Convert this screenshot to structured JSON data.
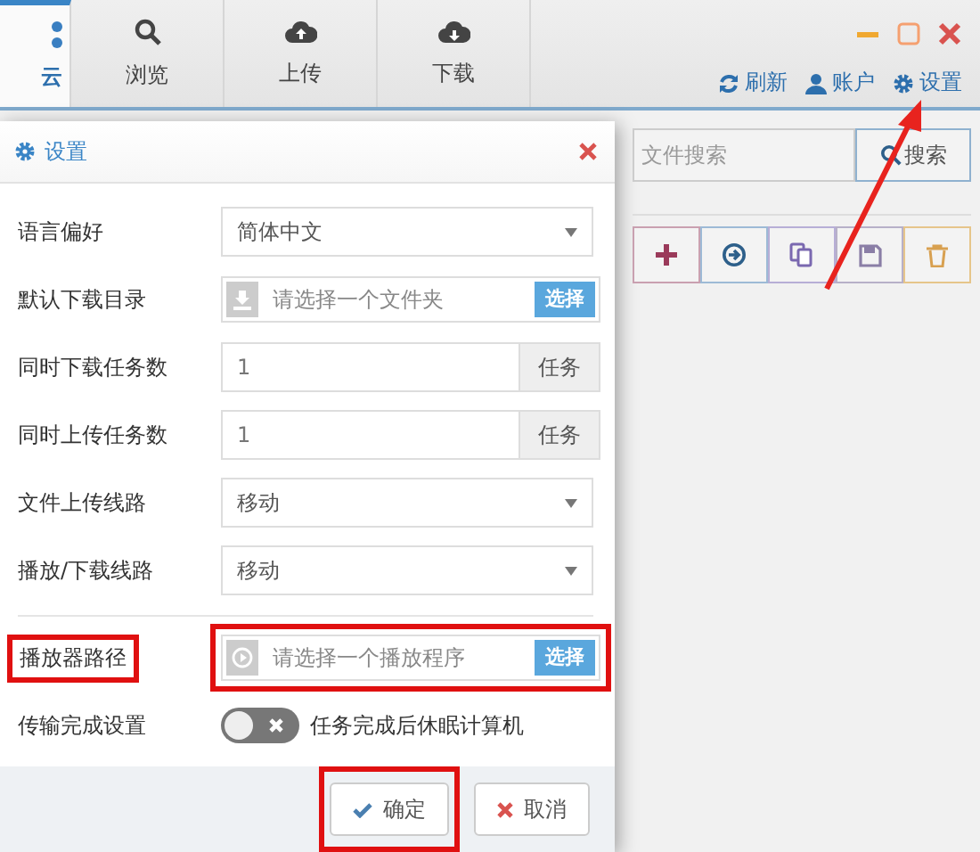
{
  "tabs": [
    {
      "label": "云",
      "selected": true
    },
    {
      "label": "浏览",
      "selected": false
    },
    {
      "label": "上传",
      "selected": false
    },
    {
      "label": "下载",
      "selected": false
    }
  ],
  "header_actions": [
    {
      "label": "刷新"
    },
    {
      "label": "账户"
    },
    {
      "label": "设置"
    }
  ],
  "search": {
    "placeholder": "文件搜索",
    "button": "搜索"
  },
  "dialog": {
    "title": "设置",
    "rows": [
      {
        "kind": "select",
        "label": "语言偏好",
        "value": "简体中文",
        "annotated": false
      },
      {
        "kind": "file",
        "label": "默认下载目录",
        "placeholder": "请选择一个文件夹",
        "button": "选择",
        "annotated": false
      },
      {
        "kind": "number",
        "label": "同时下载任务数",
        "value": "1",
        "addon": "任务",
        "annotated": false
      },
      {
        "kind": "number",
        "label": "同时上传任务数",
        "value": "1",
        "addon": "任务",
        "annotated": false
      },
      {
        "kind": "select",
        "label": "文件上传线路",
        "value": "移动",
        "annotated": false
      },
      {
        "kind": "select",
        "label": "播放/下载线路",
        "value": "移动",
        "annotated": false
      },
      {
        "kind": "file",
        "label": "播放器路径",
        "placeholder": "请选择一个播放程序",
        "button": "选择",
        "annotated": true
      },
      {
        "kind": "toggle",
        "label": "传输完成设置",
        "on": false,
        "text": "任务完成后休眠计算机",
        "annotated": false
      }
    ],
    "buttons": [
      {
        "kind": "confirm",
        "label": "确定",
        "annotated": true
      },
      {
        "kind": "cancel",
        "label": "取消",
        "annotated": false
      }
    ]
  }
}
